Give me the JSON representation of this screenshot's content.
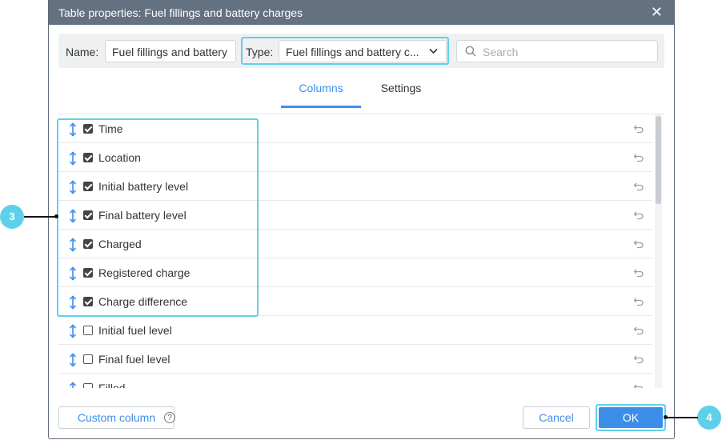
{
  "dialog": {
    "title": "Table properties: Fuel fillings and battery charges",
    "close_glyph": "✕"
  },
  "toolbar": {
    "name_label": "Name:",
    "name_value": "Fuel fillings and battery",
    "type_label": "Type:",
    "type_value": "Fuel fillings and battery c...",
    "search_placeholder": "Search"
  },
  "tabs": [
    {
      "label": "Columns",
      "active": true
    },
    {
      "label": "Settings",
      "active": false
    }
  ],
  "columns": [
    {
      "label": "Time",
      "checked": true
    },
    {
      "label": "Location",
      "checked": true
    },
    {
      "label": "Initial battery level",
      "checked": true
    },
    {
      "label": "Final battery level",
      "checked": true
    },
    {
      "label": "Charged",
      "checked": true
    },
    {
      "label": "Registered charge",
      "checked": true
    },
    {
      "label": "Charge difference",
      "checked": true
    },
    {
      "label": "Initial fuel level",
      "checked": false
    },
    {
      "label": "Final fuel level",
      "checked": false
    },
    {
      "label": "Filled",
      "checked": false
    }
  ],
  "footer": {
    "custom_column": "Custom column",
    "help": "?",
    "cancel": "Cancel",
    "ok": "OK"
  },
  "callouts": {
    "left": "3",
    "right": "4"
  },
  "colors": {
    "accent": "#3d8eea",
    "highlight": "#5fd0ea",
    "titlebar": "#637181"
  },
  "icons": [
    "close-icon",
    "chevron-down-icon",
    "search-icon",
    "drag-handle-icon",
    "checkbox-icon",
    "reset-icon",
    "help-icon"
  ]
}
